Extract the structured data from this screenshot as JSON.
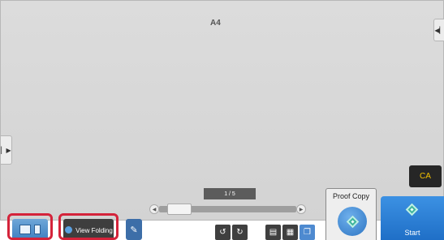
{
  "preview": {
    "paper_size": "A4",
    "page_indicator": "1 / 5",
    "page_current": 1,
    "page_total": 5,
    "slider_position_fraction": 0.0
  },
  "side_tabs": {
    "right_icon": "expand-left-arrow-icon",
    "left_icon": "expand-right-arrow-icon",
    "right_glyph": "◀▏",
    "left_glyph": "▏▶"
  },
  "actions": {
    "ca_label": "CA",
    "proof_copy_label": "Proof Copy",
    "start_label": "Start",
    "view_folding_label": "View Folding"
  },
  "toolbar": {
    "rotate_left_glyph": "↺",
    "rotate_right_glyph": "↻",
    "list_view_glyph": "▤",
    "grid_view_glyph": "▦",
    "single_view_glyph": "❐",
    "edit_glyph": "✎"
  },
  "colors": {
    "accent_blue": "#1f6fc7",
    "highlight_red": "#d4233a",
    "ca_text": "#f3c200"
  }
}
